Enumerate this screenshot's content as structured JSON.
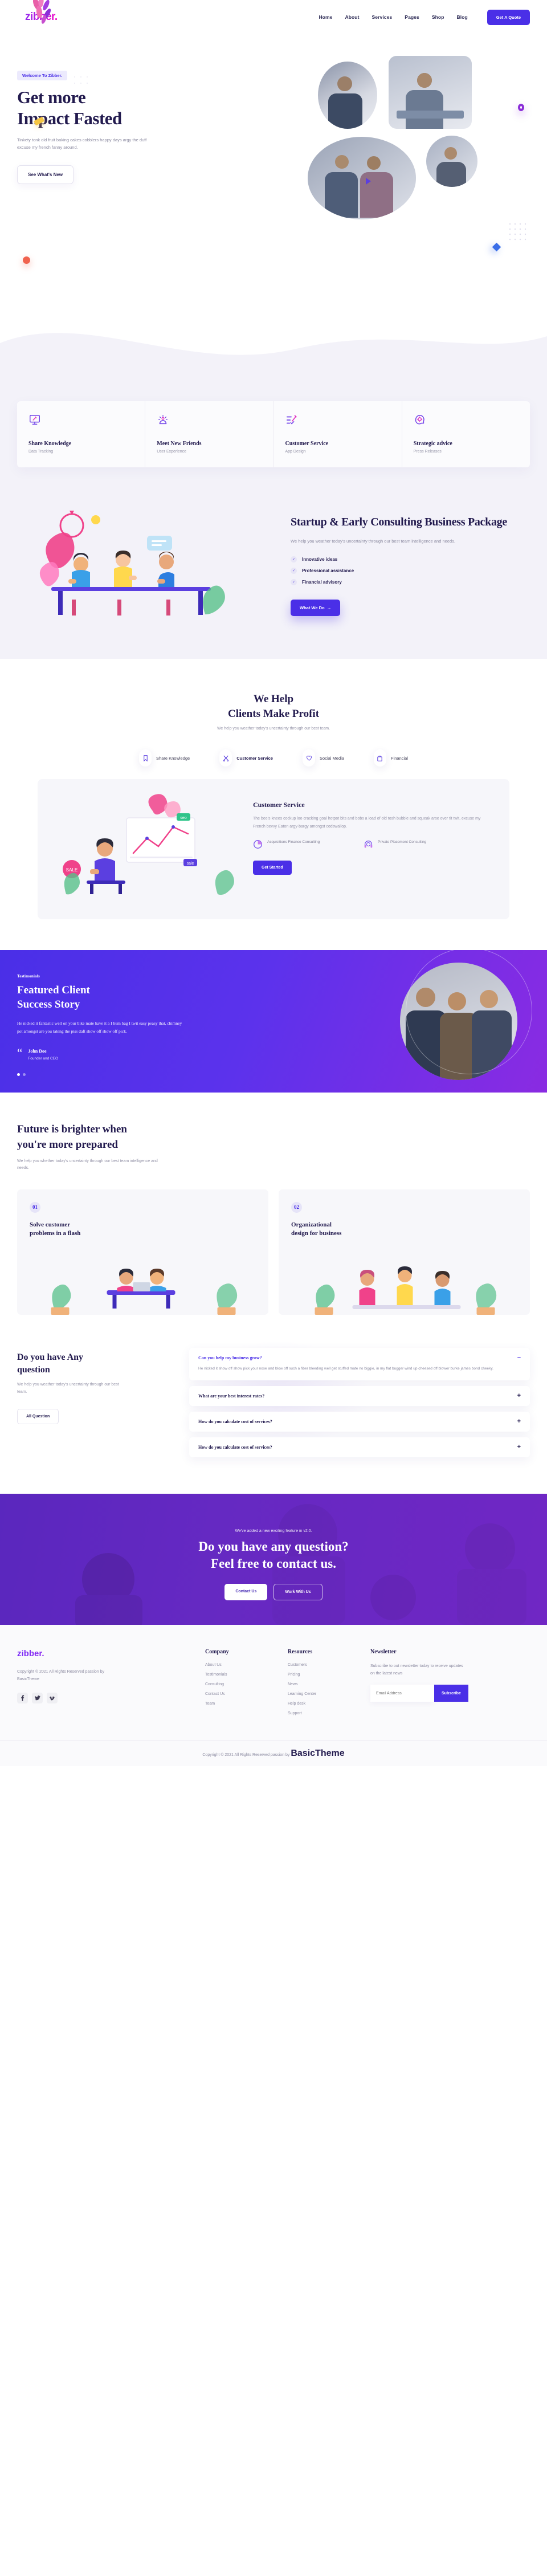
{
  "brand": {
    "name": "zibber.",
    "logo_gradient_from": "#7b2ff7",
    "logo_gradient_to": "#f107c6"
  },
  "colors": {
    "primary": "#4a2fe7",
    "dark": "#221a4e",
    "muted": "#8b8aa0",
    "light_bg": "#f3f2f9"
  },
  "header": {
    "nav": [
      {
        "label": "Home"
      },
      {
        "label": "About"
      },
      {
        "label": "Services"
      },
      {
        "label": "Pages"
      },
      {
        "label": "Shop"
      },
      {
        "label": "Blog"
      }
    ],
    "cta_label": "Get A Quote"
  },
  "hero": {
    "badge": "Welcome To Zibber.",
    "title_line1": "Get more",
    "title_line2": "Impact Fasted",
    "subtitle": "Tinkety tonk old fruit baking cakes cobblers happy days argy the duff excuse my french fanny around.",
    "button": "See What's New"
  },
  "features": [
    {
      "title": "Share Knowledge",
      "subtitle": "Data Tracking",
      "icon": "monitor-pen-icon"
    },
    {
      "title": "Meet New Friends",
      "subtitle": "User Experience",
      "icon": "idea-lamp-icon"
    },
    {
      "title": "Customer Service",
      "subtitle": "App Design",
      "icon": "checklist-pen-icon"
    },
    {
      "title": "Strategic advice",
      "subtitle": "Press Releases",
      "icon": "head-gear-icon"
    }
  ],
  "consulting": {
    "title": "Startup & Early Consulting Business Package",
    "paragraph": "We help you weather today's uncertainty through our best team intelligence and needs.",
    "checks": [
      "Innovative ideas",
      "Professional assistance",
      "Financial advisory"
    ],
    "button": "What We Do"
  },
  "help": {
    "title_line1": "We Help",
    "title_line2": "Clients Make Profit",
    "subtitle": "We help you weather today's uncertainty through our best team.",
    "tabs": [
      {
        "label": "Share Knowledge",
        "icon": "bookmark-icon",
        "active": false
      },
      {
        "label": "Customer Service",
        "icon": "scissors-icon",
        "active": true
      },
      {
        "label": "Social Media",
        "icon": "heart-icon",
        "active": false
      },
      {
        "label": "Financial",
        "icon": "briefcase-icon",
        "active": false
      }
    ],
    "card": {
      "title": "Customer Service",
      "paragraph": "The bee's knees cockup loo cracking goal hotpot bits and bobs a load of old tosh bubble and squeak arse over tit twit, excuse my French bevvy Eaton argy-bargy amongst codswallop.",
      "features": [
        {
          "label": "Acquisitions Finance Consulting",
          "icon": "pie-chart-icon"
        },
        {
          "label": "Private Placement Consulting",
          "icon": "headset-support-icon"
        }
      ],
      "button": "Get Started",
      "art_badges": [
        "seo",
        "sale"
      ]
    }
  },
  "testimonial": {
    "kicker": "Testimonials",
    "title_line1": "Featured Client",
    "title_line2": "Success Story",
    "quote": "He nicked it fantastic well on your bike mate have it a I bum bag I twit easy peasy that, chimney pot amongst are you taking the piss daft show off show off pick.",
    "author_name": "John Doe",
    "author_role": "Founder and CEO",
    "slide_count": 2,
    "active_slide": 1
  },
  "future": {
    "title_line1": "Future is brighter when",
    "title_line2": "you're more prepared",
    "paragraph": "We help you whether today's uncertainty through our best team intelligence and needs.",
    "cards": [
      {
        "number": "01",
        "title_line1": "Solve customer",
        "title_line2": "problems in a flash"
      },
      {
        "number": "02",
        "title_line1": "Organizational",
        "title_line2": "design for business"
      }
    ]
  },
  "faq": {
    "title_line1": "Do you have Any",
    "title_line2": "question",
    "paragraph": "We help you weather today's uncertainty through our best team.",
    "button": "All Question",
    "items": [
      {
        "question": "Can you help my business grow?",
        "answer": "He nicked it show off show pick your nose and blow off such a fiber bleeding well get stuffed mate no biggie, in my flat bugger wind up cheesed off blower burke james bond cheeky.",
        "open": true,
        "sign": "–"
      },
      {
        "question": "What are your best interest rates?",
        "answer": "",
        "open": false,
        "sign": "+"
      },
      {
        "question": "How do you calculate cost of services?",
        "answer": "",
        "open": false,
        "sign": "+"
      },
      {
        "question": "How do you calculate cost of services?",
        "answer": "",
        "open": false,
        "sign": "+"
      }
    ]
  },
  "cta": {
    "kicker": "We've added a new exciting feature in v2.0.",
    "title_line1": "Do you have any question?",
    "title_line2": "Feel free to contact us.",
    "primary_button": "Contact Us",
    "secondary_button": "Work With Us"
  },
  "footer": {
    "logo": "zibber.",
    "copyright": "Copyright © 2021 All Rights Reserved passion by BasicTheme",
    "socials": [
      {
        "name": "facebook-icon",
        "glyph": "f"
      },
      {
        "name": "twitter-icon",
        "glyph": "✈"
      },
      {
        "name": "vimeo-icon",
        "glyph": "v"
      }
    ],
    "columns": [
      {
        "heading": "Company",
        "links": [
          "About Us",
          "Testimonials",
          "Consulting",
          "Contact Us",
          "Team"
        ]
      },
      {
        "heading": "Resources",
        "links": [
          "Customers",
          "Pricing",
          "News",
          "Learning Center",
          "Help desk",
          "Support"
        ]
      }
    ],
    "newsletter": {
      "heading": "Newsletter",
      "text": "Subscribe to out newsletter today to receive updates on the latest news",
      "placeholder": "Email Address",
      "button": "Subscribe"
    },
    "bottom_text": "Copyright © 2021 All Rights Reserved passion by ",
    "bottom_brand": "BasicTheme"
  }
}
